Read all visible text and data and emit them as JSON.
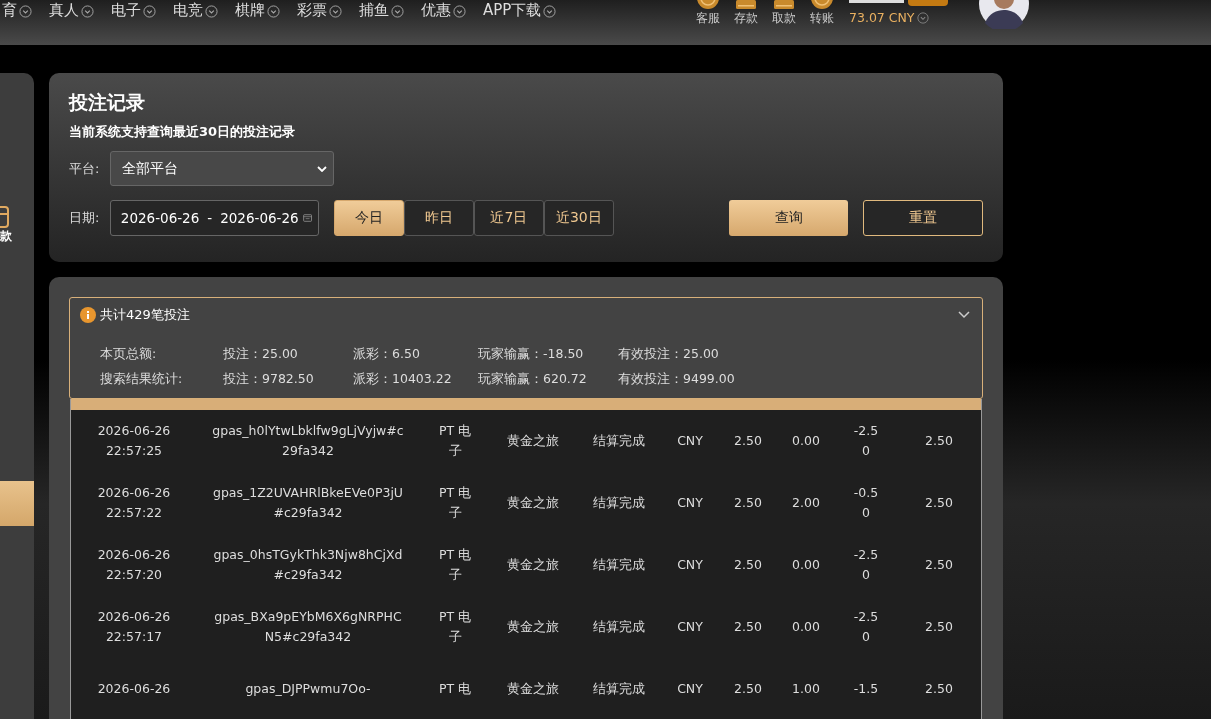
{
  "nav": {
    "items": [
      {
        "label": "育"
      },
      {
        "label": "真人"
      },
      {
        "label": "电子"
      },
      {
        "label": "电竞"
      },
      {
        "label": "棋牌"
      },
      {
        "label": "彩票"
      },
      {
        "label": "捕鱼"
      },
      {
        "label": "优惠"
      },
      {
        "label": "APP下载"
      }
    ]
  },
  "user_actions": [
    {
      "label": "客服",
      "kind": "service"
    },
    {
      "label": "存款",
      "kind": "deposit"
    },
    {
      "label": "取款",
      "kind": "withdraw"
    },
    {
      "label": "转账",
      "kind": "transfer"
    }
  ],
  "balance": "73.07 CNY",
  "sidebar": {
    "items": [
      {
        "label": "款",
        "selected": false
      },
      {
        "selected": true
      }
    ]
  },
  "filter": {
    "title": "投注记录",
    "note": "当前系统支持查询最近30日的投注记录",
    "platform_label": "平台:",
    "platform": "全部平台",
    "date_label": "日期:",
    "date_from": "2026-06-26",
    "date_separator": "-",
    "date_to": "2026-06-26",
    "quick_ranges": [
      {
        "label": "今日",
        "selected": true
      },
      {
        "label": "昨日",
        "selected": false
      },
      {
        "label": "近7日",
        "selected": false
      },
      {
        "label": "近30日",
        "selected": false
      }
    ],
    "query_button": "查询",
    "reset_button": "重置"
  },
  "summary": {
    "title": "共计429笔投注",
    "expanded": true,
    "rows": [
      {
        "label": "本页总额:",
        "values": [
          "投注：25.00",
          "派彩：6.50",
          "玩家输赢：-18.50",
          "有效投注：25.00"
        ]
      },
      {
        "label": "搜索结果统计:",
        "values": [
          "投注：9782.50",
          "派彩：10403.22",
          "玩家输赢：620.72",
          "有效投注：9499.00"
        ]
      }
    ]
  },
  "table": {
    "rows": [
      {
        "time": "2026-06-26 22:57:25",
        "order": "gpas_h0lYtwLbklfw9gLjVyjw#c29fa342",
        "platform": "PT 电子",
        "game": "黄金之旅",
        "status": "结算完成",
        "currency": "CNY",
        "bet": "2.50",
        "payout": "0.00",
        "win_loss": "-2.50",
        "valid_bet": "2.50"
      },
      {
        "time": "2026-06-26 22:57:22",
        "order": "gpas_1Z2UVAHRlBkeEVe0P3jU#c29fa342",
        "platform": "PT 电子",
        "game": "黄金之旅",
        "status": "结算完成",
        "currency": "CNY",
        "bet": "2.50",
        "payout": "2.00",
        "win_loss": "-0.50",
        "valid_bet": "2.50"
      },
      {
        "time": "2026-06-26 22:57:20",
        "order": "gpas_0hsTGykThk3Njw8hCjXd#c29fa342",
        "platform": "PT 电子",
        "game": "黄金之旅",
        "status": "结算完成",
        "currency": "CNY",
        "bet": "2.50",
        "payout": "0.00",
        "win_loss": "-2.50",
        "valid_bet": "2.50"
      },
      {
        "time": "2026-06-26 22:57:17",
        "order": "gpas_BXa9pEYbM6X6gNRPHCN5#c29fa342",
        "platform": "PT 电子",
        "game": "黄金之旅",
        "status": "结算完成",
        "currency": "CNY",
        "bet": "2.50",
        "payout": "0.00",
        "win_loss": "-2.50",
        "valid_bet": "2.50"
      },
      {
        "time": "2026-06-26",
        "order": "gpas_DJPPwmu7Oo-",
        "platform": "PT 电",
        "game": "黄金之旅",
        "status": "结算完成",
        "currency": "CNY",
        "bet": "2.50",
        "payout": "1.00",
        "win_loss": "-1.5",
        "valid_bet": "2.50"
      }
    ]
  }
}
